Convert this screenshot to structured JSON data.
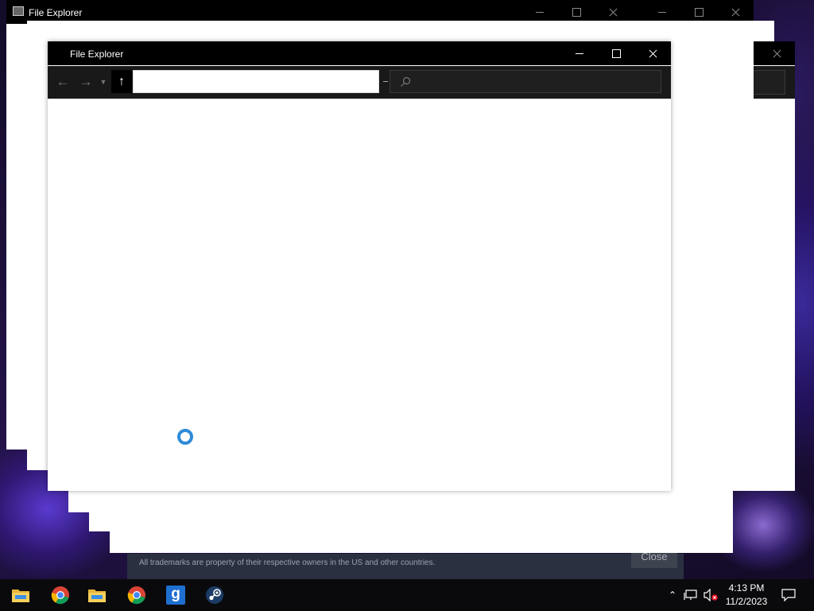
{
  "windows": {
    "back_left": {
      "title": "File Explorer"
    },
    "front": {
      "title": "File Explorer"
    }
  },
  "steam_dialog": {
    "trademark_text": "All trademarks are property of their respective owners in the US and other countries.",
    "close_label": "Close"
  },
  "taskbar": {
    "apps": [
      {
        "name": "File Explorer",
        "icon": "folder-icon"
      },
      {
        "name": "Google Chrome",
        "icon": "chrome-icon"
      },
      {
        "name": "File Explorer",
        "icon": "folder-icon"
      },
      {
        "name": "Google Chrome",
        "icon": "chrome-icon"
      },
      {
        "name": "Garry's Mod",
        "icon": "gmod-icon",
        "glyph": "g"
      },
      {
        "name": "Steam",
        "icon": "steam-icon"
      }
    ],
    "clock": {
      "time": "4:13 PM",
      "date": "11/2/2023"
    }
  },
  "colors": {
    "titlebar": "#000000",
    "toolbar": "#191919",
    "spinner": "#2f8bd8",
    "taskbar": "#0a0a0c",
    "gmod_blue": "#1f6fd1",
    "steam_blue": "#1b3b64"
  }
}
